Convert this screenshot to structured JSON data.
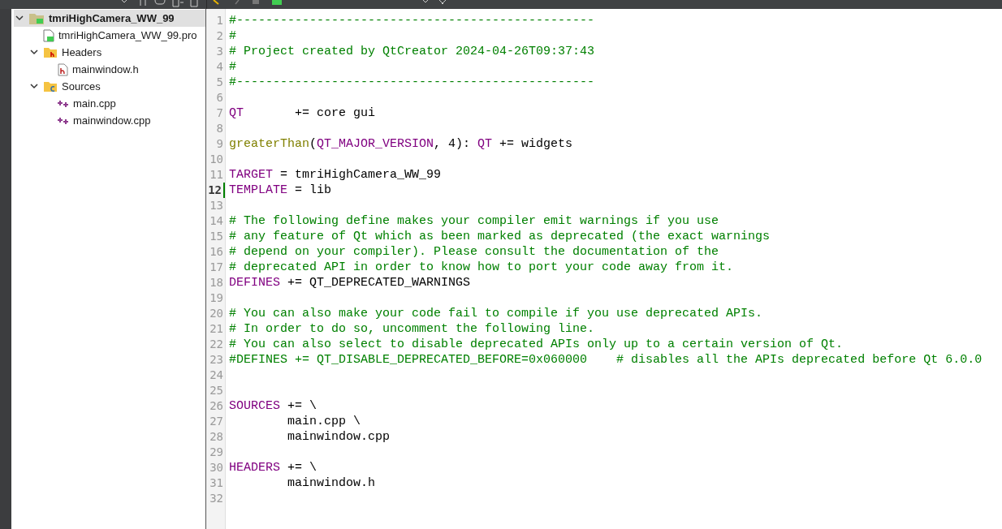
{
  "project_tree": [
    {
      "label": "tmriHighCamera_WW_99",
      "kind": "project",
      "expanded": true,
      "selected": true,
      "children": [
        {
          "label": "tmriHighCamera_WW_99.pro",
          "kind": "pro",
          "selected": false
        },
        {
          "label": "Headers",
          "kind": "header-folder",
          "expanded": true,
          "selected": false,
          "children": [
            {
              "label": "mainwindow.h",
              "kind": "header",
              "selected": false
            }
          ]
        },
        {
          "label": "Sources",
          "kind": "source-folder",
          "expanded": true,
          "selected": false,
          "children": [
            {
              "label": "main.cpp",
              "kind": "source",
              "selected": false
            },
            {
              "label": "mainwindow.cpp",
              "kind": "source",
              "selected": false
            }
          ]
        }
      ]
    }
  ],
  "editor": {
    "lines": [
      {
        "number": "1",
        "current": false,
        "tokens": [
          {
            "kind": "comment",
            "text": "#-------------------------------------------------"
          }
        ]
      },
      {
        "number": "2",
        "current": false,
        "tokens": [
          {
            "kind": "comment",
            "text": "#"
          }
        ]
      },
      {
        "number": "3",
        "current": false,
        "tokens": [
          {
            "kind": "comment",
            "text": "# Project created by QtCreator 2024-04-26T09:37:43"
          }
        ]
      },
      {
        "number": "4",
        "current": false,
        "tokens": [
          {
            "kind": "comment",
            "text": "#"
          }
        ]
      },
      {
        "number": "5",
        "current": false,
        "tokens": [
          {
            "kind": "comment",
            "text": "#-------------------------------------------------"
          }
        ]
      },
      {
        "number": "6",
        "current": false
      },
      {
        "number": "7",
        "current": false,
        "tokens": [
          {
            "kind": "keyword",
            "text": "QT"
          },
          {
            "kind": "plain",
            "text": "       += core gui"
          }
        ]
      },
      {
        "number": "8",
        "current": false
      },
      {
        "number": "9",
        "current": false,
        "tokens": [
          {
            "kind": "function",
            "text": "greaterThan"
          },
          {
            "kind": "plain",
            "text": "("
          },
          {
            "kind": "keyword",
            "text": "QT_MAJOR_VERSION"
          },
          {
            "kind": "plain",
            "text": ", 4): "
          },
          {
            "kind": "keyword",
            "text": "QT"
          },
          {
            "kind": "plain",
            "text": " += widgets"
          }
        ]
      },
      {
        "number": "10",
        "current": false
      },
      {
        "number": "11",
        "current": false,
        "tokens": [
          {
            "kind": "keyword",
            "text": "TARGET"
          },
          {
            "kind": "plain",
            "text": " = tmriHighCamera_WW_99"
          }
        ]
      },
      {
        "number": "12",
        "current": true,
        "tokens": [
          {
            "kind": "keyword",
            "text": "TEMPLATE"
          },
          {
            "kind": "plain",
            "text": " = lib"
          }
        ]
      },
      {
        "number": "13",
        "current": false
      },
      {
        "number": "14",
        "current": false,
        "tokens": [
          {
            "kind": "comment",
            "text": "# The following define makes your compiler emit warnings if you use"
          }
        ]
      },
      {
        "number": "15",
        "current": false,
        "tokens": [
          {
            "kind": "comment",
            "text": "# any feature of Qt which as been marked as deprecated (the exact warnings"
          }
        ]
      },
      {
        "number": "16",
        "current": false,
        "tokens": [
          {
            "kind": "comment",
            "text": "# depend on your compiler). Please consult the documentation of the"
          }
        ]
      },
      {
        "number": "17",
        "current": false,
        "tokens": [
          {
            "kind": "comment",
            "text": "# deprecated API in order to know how to port your code away from it."
          }
        ]
      },
      {
        "number": "18",
        "current": false,
        "tokens": [
          {
            "kind": "keyword",
            "text": "DEFINES"
          },
          {
            "kind": "plain",
            "text": " += QT_DEPRECATED_WARNINGS"
          }
        ]
      },
      {
        "number": "19",
        "current": false
      },
      {
        "number": "20",
        "current": false,
        "tokens": [
          {
            "kind": "comment",
            "text": "# You can also make your code fail to compile if you use deprecated APIs."
          }
        ]
      },
      {
        "number": "21",
        "current": false,
        "tokens": [
          {
            "kind": "comment",
            "text": "# In order to do so, uncomment the following line."
          }
        ]
      },
      {
        "number": "22",
        "current": false,
        "tokens": [
          {
            "kind": "comment",
            "text": "# You can also select to disable deprecated APIs only up to a certain version of Qt."
          }
        ]
      },
      {
        "number": "23",
        "current": false,
        "tokens": [
          {
            "kind": "comment",
            "text": "#DEFINES += QT_DISABLE_DEPRECATED_BEFORE=0x060000    # disables all the APIs deprecated before Qt 6.0.0"
          }
        ]
      },
      {
        "number": "24",
        "current": false
      },
      {
        "number": "25",
        "current": false
      },
      {
        "number": "26",
        "current": false,
        "tokens": [
          {
            "kind": "keyword",
            "text": "SOURCES"
          },
          {
            "kind": "plain",
            "text": " += \\"
          }
        ]
      },
      {
        "number": "27",
        "current": false,
        "tokens": [
          {
            "kind": "plain",
            "text": "        main.cpp \\"
          }
        ]
      },
      {
        "number": "28",
        "current": false,
        "tokens": [
          {
            "kind": "plain",
            "text": "        mainwindow.cpp"
          }
        ]
      },
      {
        "number": "29",
        "current": false
      },
      {
        "number": "30",
        "current": false,
        "tokens": [
          {
            "kind": "keyword",
            "text": "HEADERS"
          },
          {
            "kind": "plain",
            "text": " += \\"
          }
        ]
      },
      {
        "number": "31",
        "current": false,
        "tokens": [
          {
            "kind": "plain",
            "text": "        mainwindow.h"
          }
        ]
      },
      {
        "number": "32",
        "current": false
      }
    ]
  }
}
